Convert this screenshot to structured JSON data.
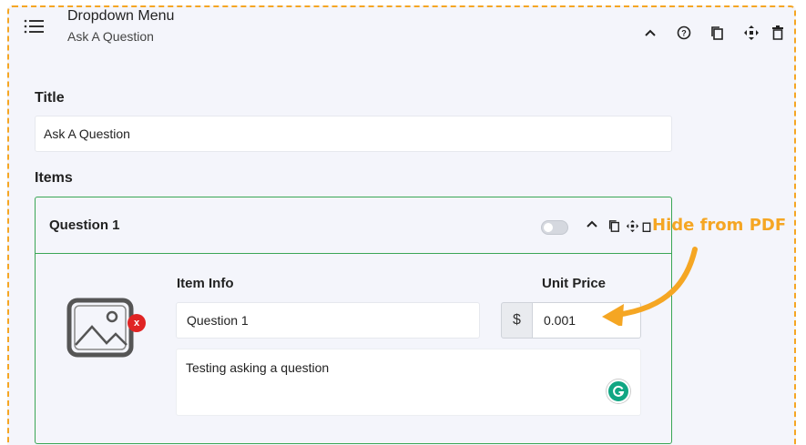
{
  "header": {
    "icon": "list-icon",
    "title": "Dropdown Menu",
    "subtitle": "Ask A Question",
    "tools": [
      "chevron-up-icon",
      "help-icon",
      "copy-icon",
      "move-icon",
      "trash-icon"
    ]
  },
  "form": {
    "title_label": "Title",
    "title_value": "Ask A Question",
    "items_label": "Items"
  },
  "item": {
    "heading": "Question 1",
    "toggle_on": false,
    "item_info_label": "Item Info",
    "unit_price_label": "Unit Price",
    "item_name": "Question 1",
    "currency_symbol": "$",
    "unit_price": "0.001",
    "description": "Testing asking a question",
    "image_icon": "image-placeholder-icon",
    "remove_icon": "x",
    "tools": [
      "chevron-up-icon",
      "copy-icon",
      "move-icon",
      "trash-icon"
    ]
  },
  "annotation": {
    "text": "Hide from PDF",
    "color": "#f5a623"
  },
  "colors": {
    "dashed_border": "#f5a623",
    "card_border": "#3aa655",
    "remove_badge": "#e02424",
    "grammarly": "#11a683"
  }
}
